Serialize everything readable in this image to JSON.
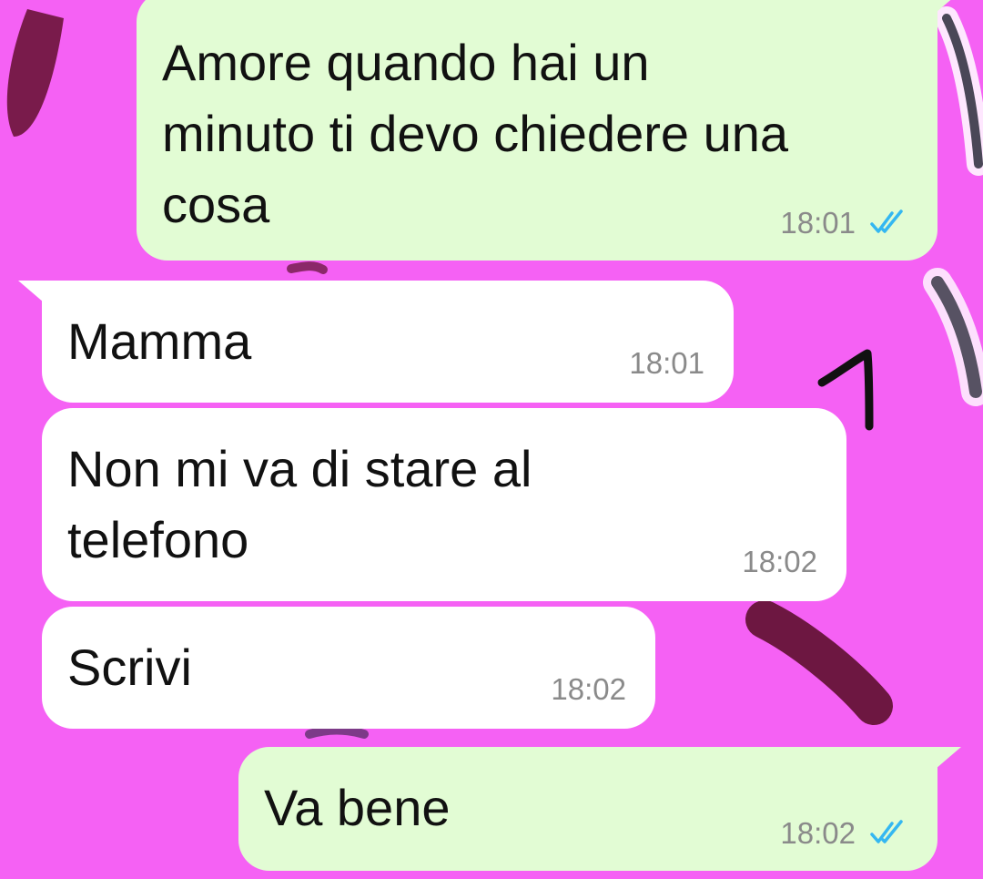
{
  "colors": {
    "background": "#f561f4",
    "outgoing_bubble": "#e2fcd4",
    "incoming_bubble": "#ffffff",
    "read_ticks": "#34b7f1",
    "timestamp": "#8a8a8a"
  },
  "messages": [
    {
      "direction": "outgoing",
      "text": "Amore quando hai un\nminuto ti devo chiedere una\ncosa",
      "time": "18:01",
      "status_icon": "double-check-read-icon"
    },
    {
      "direction": "incoming",
      "text": "Mamma",
      "time": "18:01"
    },
    {
      "direction": "incoming",
      "text": "Non mi va di stare al\ntelefono",
      "time": "18:02"
    },
    {
      "direction": "incoming",
      "text": "Scrivi",
      "time": "18:02"
    },
    {
      "direction": "outgoing",
      "text": "Va bene",
      "time": "18:02",
      "status_icon": "double-check-read-icon"
    }
  ],
  "annotation": {
    "icon": "handwritten-number-one"
  }
}
